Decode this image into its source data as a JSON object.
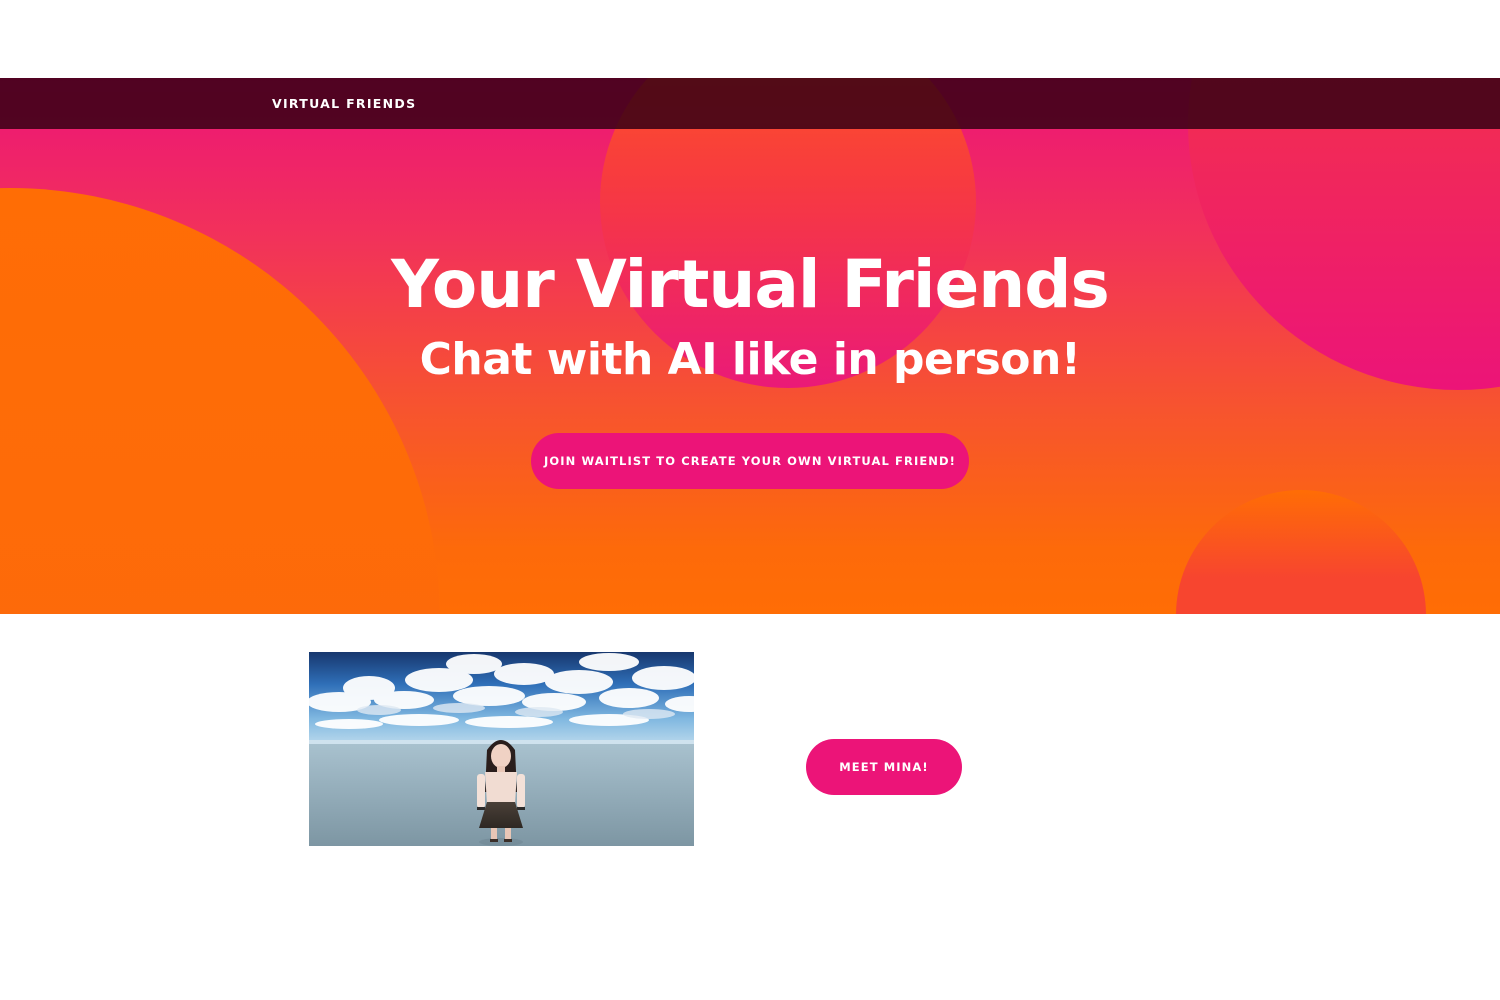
{
  "navbar": {
    "brand": "VIRTUAL FRIENDS"
  },
  "hero": {
    "title": "Your Virtual Friends",
    "subtitle": "Chat with AI like in person!",
    "cta_label": "JOIN WAITLIST TO CREATE YOUR OWN VIRTUAL FRIEND!"
  },
  "feature": {
    "image_subject": "3D avatar standing under a cloudy blue sky",
    "button_label": "MEET MINA!"
  },
  "colors": {
    "accent_pink": "#ec1478",
    "accent_orange": "#ff6d05",
    "navbar_bg": "#370014",
    "text_white": "#ffffff"
  }
}
